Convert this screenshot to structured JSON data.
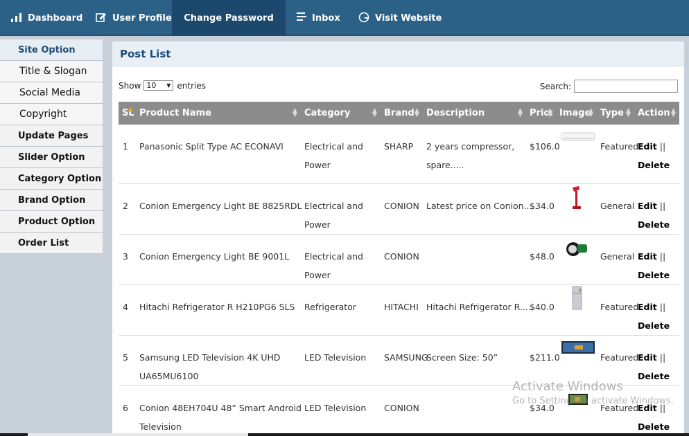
{
  "nav": {
    "items": [
      {
        "label": "Dashboard",
        "icon": "bar-chart-icon"
      },
      {
        "label": "User Profile",
        "icon": "edit-icon"
      },
      {
        "label": "Change Password",
        "icon": ""
      },
      {
        "label": "Inbox",
        "icon": "list-icon"
      },
      {
        "label": "Visit Website",
        "icon": "globe-icon"
      }
    ],
    "active": "Change Password"
  },
  "sidebar": {
    "heading": "Site Option",
    "sub_items": [
      "Title & Slogan",
      "Social Media",
      "Copyright"
    ],
    "sections": [
      "Update Pages",
      "Slider Option",
      "Category Option",
      "Brand Option",
      "Product Option",
      "Order List"
    ]
  },
  "panel": {
    "title": "Post List",
    "show_label": "Show",
    "entries_value": "10",
    "entries_label": "entries",
    "search_label": "Search:",
    "search_value": ""
  },
  "table": {
    "columns": [
      "SL",
      "Product Name",
      "Category",
      "Brand",
      "Description",
      "Price",
      "Image",
      "Type",
      "Action"
    ],
    "edit_label": "Edit",
    "separator": "||",
    "delete_label": "Delete",
    "rows": [
      {
        "sl": "1",
        "name": [
          "Panasonic Split Type AC ECONAVI"
        ],
        "category": [
          "Electrical and",
          "Power"
        ],
        "brand": "SHARP",
        "description": [
          "2 years compressor,",
          "spare....."
        ],
        "price": "$106.0",
        "image": "air-conditioner-thumbnail",
        "type": "Featured"
      },
      {
        "sl": "2",
        "name": [
          "Conion Emergency Light BE 8825RDL"
        ],
        "category": [
          "Electrical and",
          "Power"
        ],
        "brand": "CONION",
        "description": [
          "Latest price on Conion....."
        ],
        "price": "$34.0",
        "image": "red-lamp-thumbnail",
        "type": "General"
      },
      {
        "sl": "3",
        "name": [
          "Conion Emergency Light BE 9001L"
        ],
        "category": [
          "Electrical and",
          "Power"
        ],
        "brand": "CONION",
        "description": [
          ""
        ],
        "price": "$48.0",
        "image": "torch-light-thumbnail",
        "type": "General"
      },
      {
        "sl": "4",
        "name": [
          "Hitachi Refrigerator R H210PG6 SLS"
        ],
        "category": [
          "Refrigerator"
        ],
        "brand": "HITACHI",
        "description": [
          "Hitachi Refrigerator R....."
        ],
        "price": "$40.0",
        "image": "refrigerator-thumbnail",
        "type": "Featured"
      },
      {
        "sl": "5",
        "name": [
          "Samsung LED Television 4K UHD",
          "UA65MU6100"
        ],
        "category": [
          "LED Television"
        ],
        "brand": "SAMSUNG",
        "description": [
          "Screen Size: 50”"
        ],
        "price": "$211.0",
        "image": "television-thumbnail",
        "type": "Featured"
      },
      {
        "sl": "6",
        "name": [
          "Conion 48EH704U 48” Smart Android",
          "Television"
        ],
        "category": [
          "LED Television"
        ],
        "brand": "CONION",
        "description": [
          ""
        ],
        "price": "$34.0",
        "image": "television-thumbnail",
        "type": "Featured"
      }
    ]
  },
  "watermark": {
    "line1": "Activate Windows",
    "line2": "Go to Settings to activate Windows."
  },
  "colors": {
    "nav_bg": "#2c6187",
    "nav_active": "#1b486c",
    "header_gray": "#8c8c8c",
    "accent_blue": "#1d4d76"
  }
}
